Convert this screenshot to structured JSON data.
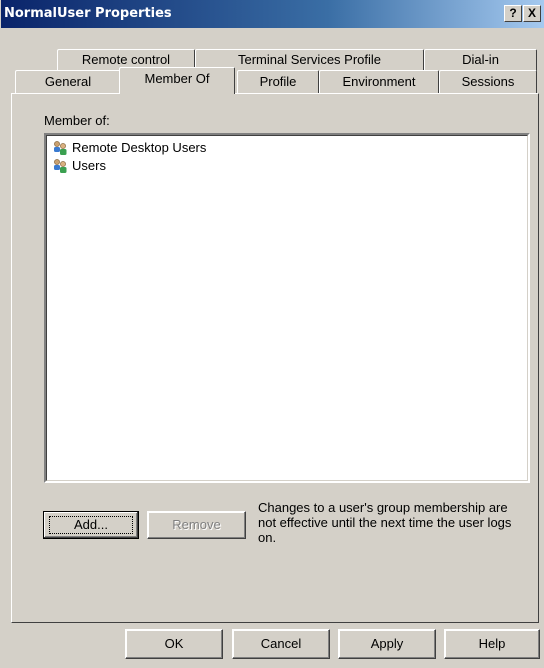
{
  "window": {
    "title": "NormalUser Properties",
    "help_label": "?",
    "close_label": "X"
  },
  "tabs": {
    "row_back": [
      "Remote control",
      "Terminal Services Profile",
      "Dial-in"
    ],
    "row_front": [
      "General",
      "Member Of",
      "Profile",
      "Environment",
      "Sessions"
    ],
    "active": "Member Of"
  },
  "member_of": {
    "label": "Member of:",
    "groups": [
      {
        "name": "Remote Desktop Users",
        "icon": "group-icon"
      },
      {
        "name": "Users",
        "icon": "group-icon"
      }
    ]
  },
  "buttons": {
    "add": "Add...",
    "remove": "Remove"
  },
  "note": "Changes to a user's group membership are not effective until the next time the user logs on.",
  "footer": {
    "ok": "OK",
    "cancel": "Cancel",
    "apply": "Apply",
    "help": "Help"
  }
}
